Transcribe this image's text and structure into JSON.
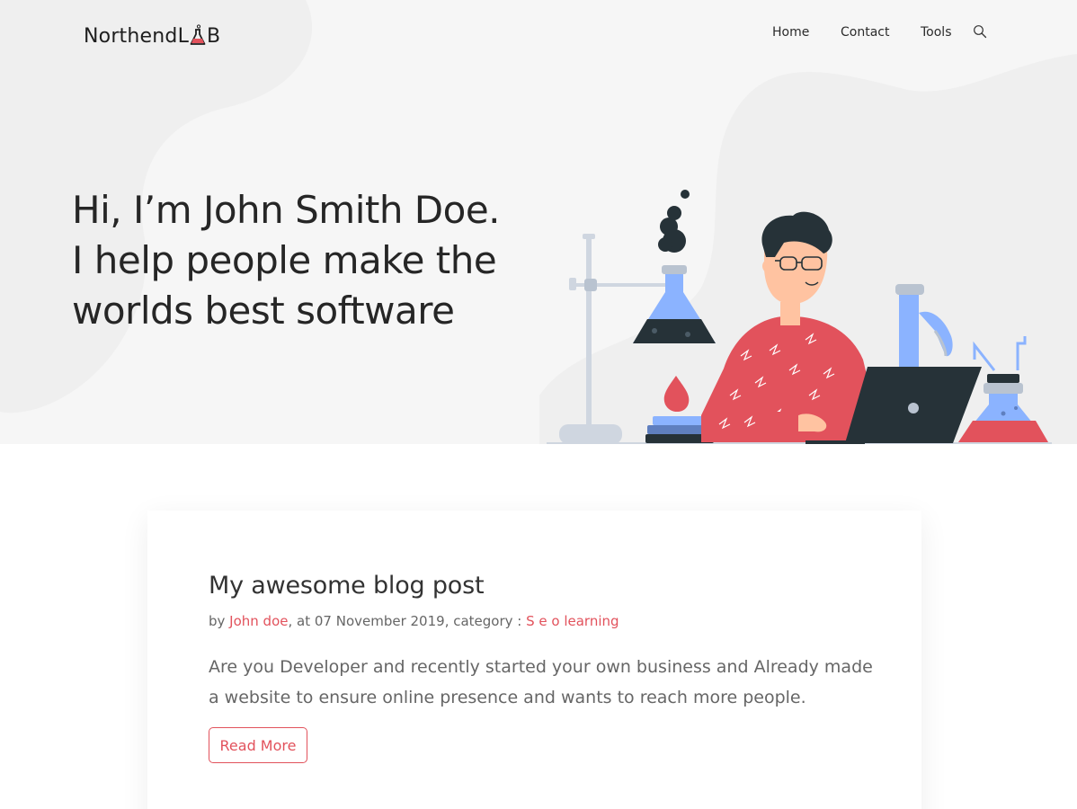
{
  "brand": {
    "logo_text_left": "NorthendL",
    "logo_text_right": "B",
    "accent_color": "#e2525c"
  },
  "nav": {
    "items": [
      {
        "label": "Home"
      },
      {
        "label": "Contact"
      },
      {
        "label": "Tools"
      }
    ],
    "search_icon": "search-icon"
  },
  "hero": {
    "title_lines": [
      "Hi, I’m John Smith Doe.",
      "I help people make the",
      "worlds best software"
    ],
    "illustration": "developer-lab-illustration"
  },
  "post": {
    "title": "My awesome blog post",
    "meta_prefix": "by ",
    "author": "John doe",
    "meta_middle": ", at 07 November 2019, category : ",
    "category": "S e o learning",
    "excerpt": "Are you Developer and recently started your own business and Already made a website to ensure online presence and wants to reach more people.",
    "read_more_label": "Read More"
  }
}
